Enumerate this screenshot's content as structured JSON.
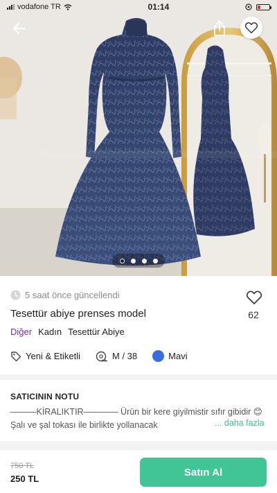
{
  "status_bar": {
    "carrier": "vodafone TR",
    "time": "01:14"
  },
  "listing": {
    "updated": "5 saat önce güncellendi",
    "title": "Tesettür abiye prenses model",
    "like_count": "62",
    "categories": [
      "Diğer",
      "Kadın",
      "Tesettür Abiye"
    ],
    "attributes": {
      "condition": "Yeni & Etiketli",
      "size": "M / 38",
      "color_name": "Mavi",
      "color_hex": "#3c6de0"
    },
    "image_count": 4,
    "active_image_index": 0
  },
  "seller_note": {
    "heading": "SATICININ NOTU",
    "text": "———KİRALIKTIR———— Ürün bir kere giyilmistir sıfır gibidir 😊 Şalı ve şal tokası ile birlikte yollanacak",
    "more_label": "... daha fazla"
  },
  "purchase": {
    "old_price": "750 TL",
    "price": "250 TL",
    "buy_label": "Satın Al"
  },
  "colors": {
    "accent": "#41c496",
    "brand": "#6a2fa0",
    "battery": "#e0342b"
  },
  "icons": [
    "back-arrow-icon",
    "share-icon",
    "heart-icon",
    "clock-icon",
    "tag-icon",
    "tape-measure-icon"
  ]
}
